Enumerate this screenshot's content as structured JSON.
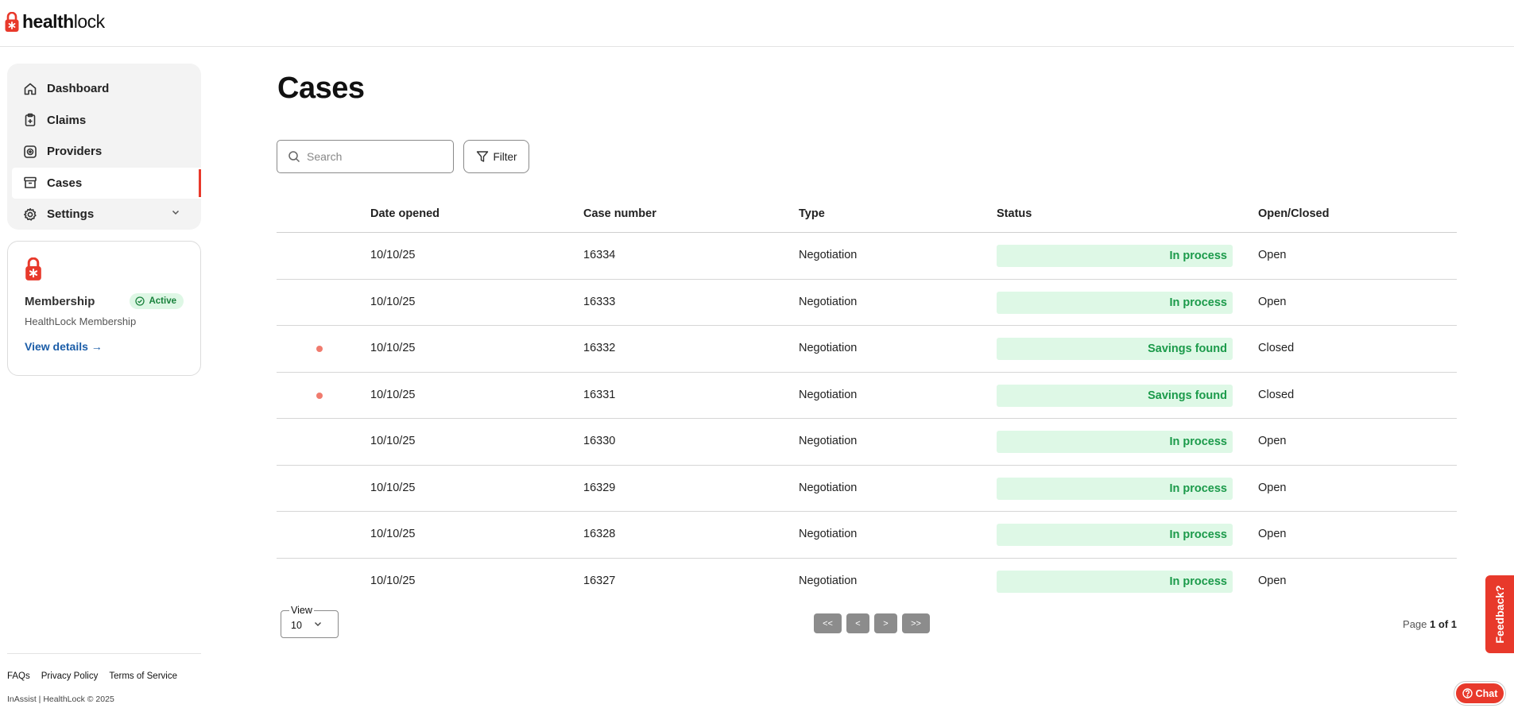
{
  "brand": {
    "name_bold": "health",
    "name_rest": "lock",
    "accent": "#e8392b"
  },
  "sidebar": {
    "items": [
      {
        "label": "Dashboard",
        "icon": "home-icon"
      },
      {
        "label": "Claims",
        "icon": "clipboard-icon"
      },
      {
        "label": "Providers",
        "icon": "provider-icon"
      },
      {
        "label": "Cases",
        "icon": "archive-icon",
        "active": true
      },
      {
        "label": "Settings",
        "icon": "gear-icon"
      }
    ]
  },
  "membership": {
    "title": "Membership",
    "status": "Active",
    "subtitle": "HealthLock Membership",
    "link": "View details"
  },
  "footer": {
    "links": [
      "FAQs",
      "Privacy Policy",
      "Terms of Service"
    ],
    "copyright": "InAssist | HealthLock © 2025"
  },
  "page": {
    "title": "Cases"
  },
  "search": {
    "placeholder": "Search"
  },
  "filter": {
    "label": "Filter"
  },
  "table": {
    "columns": [
      "Date opened",
      "Case number",
      "Type",
      "Status",
      "Open/Closed"
    ],
    "rows": [
      {
        "date": "10/10/25",
        "case": "16334",
        "type": "Negotiation",
        "status": "In process",
        "oc": "Open",
        "unread": false
      },
      {
        "date": "10/10/25",
        "case": "16333",
        "type": "Negotiation",
        "status": "In process",
        "oc": "Open",
        "unread": false
      },
      {
        "date": "10/10/25",
        "case": "16332",
        "type": "Negotiation",
        "status": "Savings found",
        "oc": "Closed",
        "unread": true
      },
      {
        "date": "10/10/25",
        "case": "16331",
        "type": "Negotiation",
        "status": "Savings found",
        "oc": "Closed",
        "unread": true
      },
      {
        "date": "10/10/25",
        "case": "16330",
        "type": "Negotiation",
        "status": "In process",
        "oc": "Open",
        "unread": false
      },
      {
        "date": "10/10/25",
        "case": "16329",
        "type": "Negotiation",
        "status": "In process",
        "oc": "Open",
        "unread": false
      },
      {
        "date": "10/10/25",
        "case": "16328",
        "type": "Negotiation",
        "status": "In process",
        "oc": "Open",
        "unread": false
      },
      {
        "date": "10/10/25",
        "case": "16327",
        "type": "Negotiation",
        "status": "In process",
        "oc": "Open",
        "unread": false
      }
    ]
  },
  "pagination": {
    "view_label": "View",
    "view_value": "10",
    "buttons": [
      "<<",
      "<",
      ">",
      ">>"
    ],
    "page_prefix": "Page",
    "page_value": "1 of 1"
  },
  "widgets": {
    "feedback": "Feedback?",
    "chat": "Chat"
  }
}
